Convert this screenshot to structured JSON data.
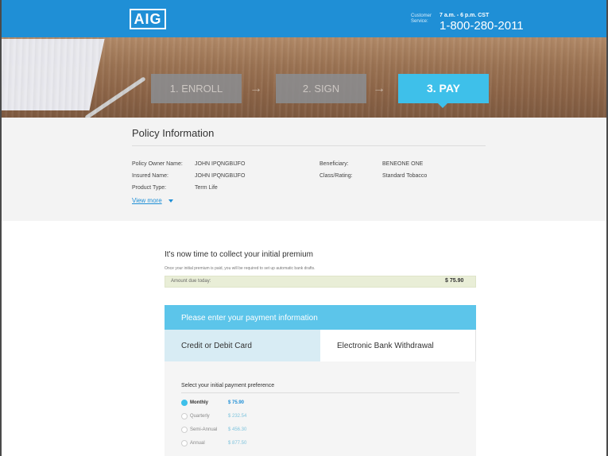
{
  "header": {
    "logo_text": "AIG",
    "customer_service_label": "Customer Service:",
    "hours": "7 a.m. - 6 p.m. CST",
    "phone": "1-800-280-2011"
  },
  "steps": [
    {
      "label": "1. ENROLL",
      "state": "done"
    },
    {
      "label": "2. SIGN",
      "state": "done"
    },
    {
      "label": "3. PAY",
      "state": "active"
    }
  ],
  "step_arrow": "→",
  "policy": {
    "title": "Policy Information",
    "owner_label": "Policy Owner Name:",
    "owner_value": "JOHN IPQNGBIJFO",
    "insured_label": "Insured Name:",
    "insured_value": "JOHN IPQNGBIJFO",
    "product_label": "Product Type:",
    "product_value": "Term Life",
    "beneficiary_label": "Beneficiary:",
    "beneficiary_value": "BENEONE ONE",
    "class_label": "Class/Rating:",
    "class_value": "Standard Tobacco",
    "view_more": "View more"
  },
  "premium": {
    "title": "It's now time to collect your initial premium",
    "subtitle": "Once your initial premium is paid, you will be required to set up automatic bank drafts.",
    "due_label": "Amount due today:",
    "due_amount": "$ 75.90"
  },
  "payment": {
    "header": "Please enter your payment information",
    "tabs": [
      {
        "label": "Credit or Debit Card",
        "active": true
      },
      {
        "label": "Electronic Bank Withdrawal",
        "active": false
      }
    ],
    "preference_title": "Select your initial payment preference",
    "options": [
      {
        "label": "Monthly",
        "amount": "$ 75.90",
        "selected": true
      },
      {
        "label": "Quarterly",
        "amount": "$ 232.54",
        "selected": false
      },
      {
        "label": "Semi-Annual",
        "amount": "$ 456.30",
        "selected": false
      },
      {
        "label": "Annual",
        "amount": "$ 877.50",
        "selected": false
      }
    ]
  },
  "colors": {
    "brand_blue": "#1f8fd6",
    "accent_cyan": "#3ec0ea",
    "payment_header": "#5cc5ea",
    "due_bar": "#e9eed7"
  }
}
